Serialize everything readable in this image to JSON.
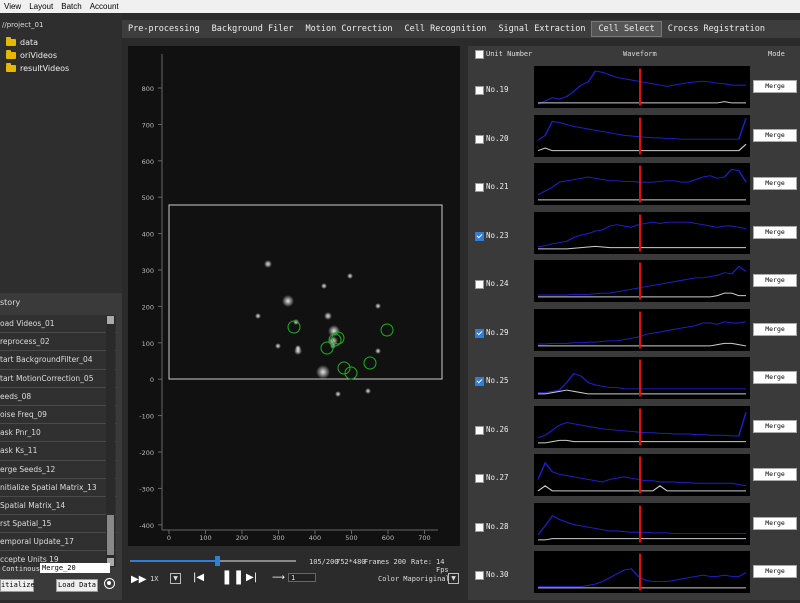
{
  "menu": [
    "View",
    "Layout",
    "Batch",
    "Account"
  ],
  "tree": {
    "root": "//project_01",
    "folders": [
      "data",
      "oriVideos",
      "resultVideos"
    ]
  },
  "history": {
    "title": "story",
    "items": [
      "oad Videos_01",
      "reprocess_02",
      "tart BackgroundFilter_04",
      "tart MotionCorrection_05",
      "eeds_08",
      "oise Freq_09",
      "ask Pnr_10",
      "ask Ks_11",
      "erge Seeds_12",
      "nitialize Spatial Matrix_13",
      "Spatial Matrix_14",
      "rst Spatial_15",
      "emporal Update_17",
      "ccepte Units 19"
    ]
  },
  "left_controls": {
    "mode_label": "Continous",
    "mode_value": "Merge_20",
    "initialize_label": "itialize",
    "load_label": "Load Data"
  },
  "tabs": [
    "Pre-processing",
    "Background Filer",
    "Motion Correction",
    "Cell Recognition",
    "Signal Extraction",
    "Cell Select",
    "Crocss Registration"
  ],
  "active_tab": "Cell Select",
  "viewer": {
    "y_ticks": [
      "800",
      "700",
      "600",
      "500",
      "400",
      "300",
      "200",
      "100",
      "0",
      "-100",
      "-200",
      "-300",
      "-400"
    ],
    "x_ticks": [
      "0",
      "100",
      "200",
      "300",
      "400",
      "500",
      "600",
      "700"
    ]
  },
  "playback": {
    "frame_info": "105/200",
    "resolution": "752*480",
    "frames": "Frames 200",
    "rate_label": "Rate:",
    "rate_value": "14 Fps",
    "speed": "1X",
    "step_value": "1",
    "colormap_label": "Color Map",
    "colormap_value": "original",
    "progress": 0.525
  },
  "units_header": {
    "unit_number": "Unit Number",
    "waveform": "Waveform",
    "mode": "Mode"
  },
  "units": [
    {
      "label": "No.19",
      "checked": false,
      "merge": "Merge"
    },
    {
      "label": "No.20",
      "checked": false,
      "merge": "Merge"
    },
    {
      "label": "No.21",
      "checked": false,
      "merge": "Merge"
    },
    {
      "label": "No.23",
      "checked": true,
      "merge": "Merge"
    },
    {
      "label": "No.24",
      "checked": false,
      "merge": "Merge"
    },
    {
      "label": "No.29",
      "checked": true,
      "merge": "Merge"
    },
    {
      "label": "No.25",
      "checked": true,
      "merge": "Merge"
    },
    {
      "label": "No.26",
      "checked": false,
      "merge": "Merge"
    },
    {
      "label": "No.27",
      "checked": false,
      "merge": "Merge"
    },
    {
      "label": "No.28",
      "checked": false,
      "merge": "Merge"
    },
    {
      "label": "No.30",
      "checked": false,
      "merge": "Merge"
    }
  ],
  "colors": {
    "trace_blue": "#2020c8",
    "trace_white": "#cccccc",
    "marker_red": "#e01010",
    "roi_green": "#20b020",
    "accent_blue": "#2f7fd6"
  }
}
